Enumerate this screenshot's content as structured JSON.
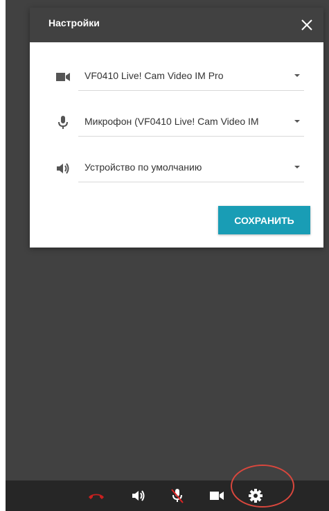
{
  "dialog": {
    "title": "Настройки",
    "camera": {
      "value": "VF0410 Live! Cam Video IM Pro",
      "icon": "video-camera-icon"
    },
    "microphone": {
      "value": "Микрофон (VF0410 Live! Cam Video IM",
      "icon": "microphone-icon"
    },
    "speaker": {
      "value": "Устройство по умолчанию",
      "icon": "speaker-icon"
    },
    "save_label": "СОХРАНИТЬ"
  },
  "toolbar": {
    "buttons": [
      "hang-up-icon",
      "speaker-icon",
      "microphone-muted-icon",
      "video-camera-icon",
      "gear-icon"
    ]
  },
  "colors": {
    "accent": "#199db5",
    "header_bg": "#414141",
    "toolbar_bg": "#262626",
    "hangup": "#c9201f",
    "highlight": "#d9473d"
  }
}
